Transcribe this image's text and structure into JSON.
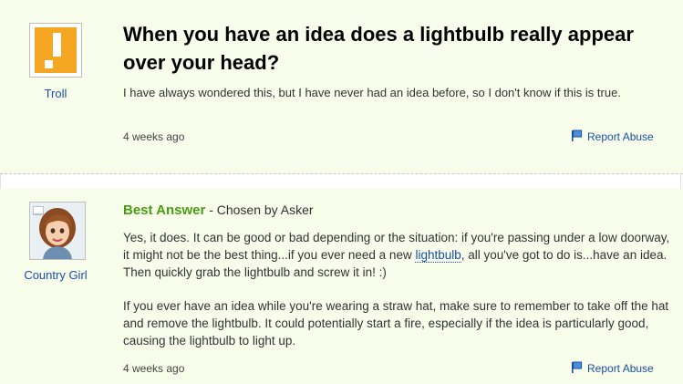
{
  "question": {
    "asker_name": "Troll",
    "asker_avatar_icon": "orange-exclamation-avatar-icon",
    "title": "When you have an idea does a lightbulb really appear over your head?",
    "body": "I have always wondered this, but I have never had an idea before, so I don't know if this is true.",
    "time": "4 weeks ago",
    "report_label": "Report Abuse",
    "report_icon": "flag-icon"
  },
  "answer": {
    "answerer_name": "Country Girl",
    "answerer_avatar_icon": "cartoon-girl-avatar-icon",
    "best_label": "Best Answer",
    "chosen_by": " - Chosen by Asker",
    "p1_before": "Yes, it does. It can be good or bad depending or the situation: if you're passing under a low doorway, it might not be the best thing...if you ever need a new ",
    "p1_link": "lightbulb",
    "p1_after": ", all you've got to do is...have an idea. Then quickly grab the lightbulb and screw it in! :)",
    "p2": "If you ever have an idea while you're wearing a straw hat, make sure to remember to take off the hat and remove the lightbulb. It could potentially start a fire, especially if the idea is particularly good, causing the lightbulb to light up.",
    "time": "4 weeks ago",
    "report_label": "Report Abuse",
    "report_icon": "flag-icon"
  },
  "colors": {
    "accent_green": "#4b9b12",
    "link_blue": "#1a4fa3",
    "panel_bg": "#f8fdeb",
    "avatar_orange": "#f5a623"
  }
}
